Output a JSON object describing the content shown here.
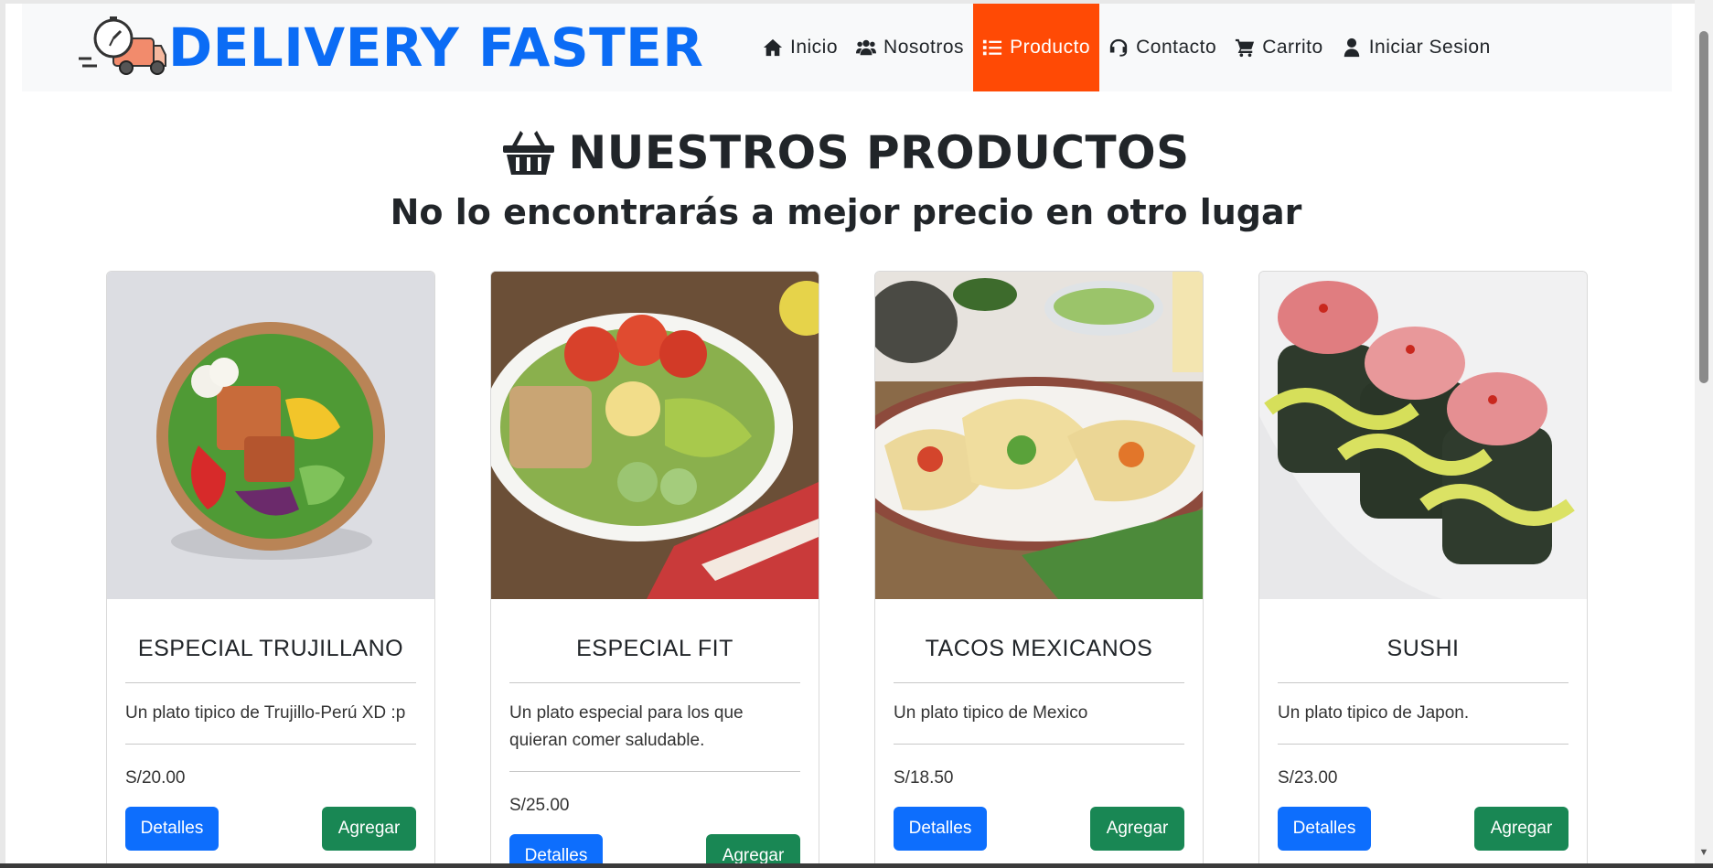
{
  "brand": {
    "name": "DELIVERY FASTER"
  },
  "nav": {
    "items": [
      {
        "label": "Inicio",
        "icon": "home-icon"
      },
      {
        "label": "Nosotros",
        "icon": "users-icon"
      },
      {
        "label": "Producto",
        "icon": "list-icon",
        "active": true
      },
      {
        "label": "Contacto",
        "icon": "headset-icon"
      },
      {
        "label": "Carrito",
        "icon": "cart-icon"
      },
      {
        "label": "Iniciar Sesion",
        "icon": "user-icon"
      }
    ]
  },
  "main": {
    "title": "NUESTROS PRODUCTOS",
    "subtitle": "No lo encontrarás a mejor precio en otro lugar"
  },
  "products": [
    {
      "name": "ESPECIAL TRUJILLANO",
      "description": "Un plato tipico de Trujillo-Perú XD :p",
      "price": "S/20.00",
      "details_label": "Detalles",
      "add_label": "Agregar"
    },
    {
      "name": "ESPECIAL FIT",
      "description": "Un plato especial para los que quieran comer saludable.",
      "price": "S/25.00",
      "details_label": "Detalles",
      "add_label": "Agregar"
    },
    {
      "name": "TACOS MEXICANOS",
      "description": "Un plato tipico de Mexico",
      "price": "S/18.50",
      "details_label": "Detalles",
      "add_label": "Agregar"
    },
    {
      "name": "SUSHI",
      "description": "Un plato tipico de Japon.",
      "price": "S/23.00",
      "details_label": "Detalles",
      "add_label": "Agregar"
    }
  ],
  "colors": {
    "brand_blue": "#0b6cf5",
    "active_nav": "#ff4a05",
    "btn_primary": "#0d6efd",
    "btn_success": "#198754"
  }
}
